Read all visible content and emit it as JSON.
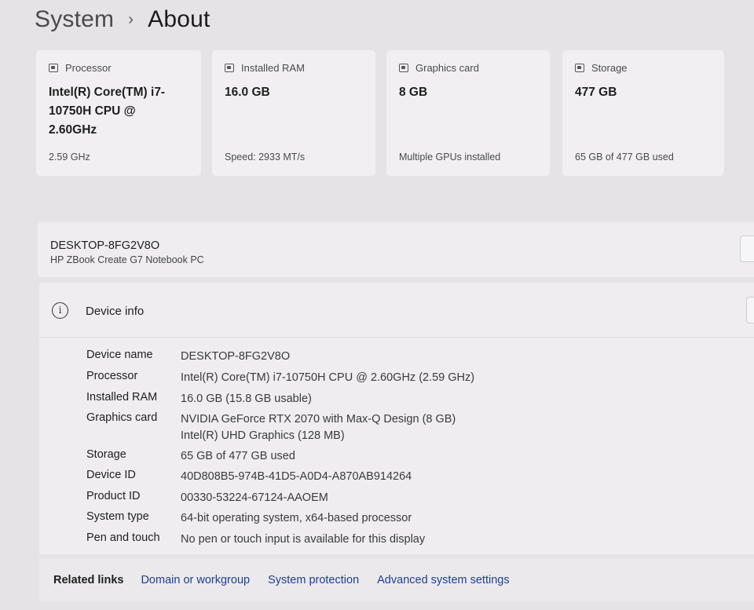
{
  "breadcrumb": {
    "parent": "System",
    "separator": "›",
    "current": "About"
  },
  "cards": [
    {
      "label": "Processor",
      "icon": "processor-icon",
      "value": "Intel(R) Core(TM) i7-10750H CPU @ 2.60GHz",
      "sub": "2.59 GHz"
    },
    {
      "label": "Installed RAM",
      "icon": "ram-icon",
      "value": "16.0 GB",
      "sub": "Speed: 2933 MT/s"
    },
    {
      "label": "Graphics card",
      "icon": "graphics-card-icon",
      "value": "8 GB",
      "sub": "Multiple GPUs installed"
    },
    {
      "label": "Storage",
      "icon": "storage-icon",
      "value": "477 GB",
      "sub": "65 GB of 477 GB used"
    }
  ],
  "device": {
    "name": "DESKTOP-8FG2V8O",
    "model": "HP ZBook Create G7 Notebook PC"
  },
  "device_info": {
    "title": "Device info",
    "icon": "info-icon",
    "specs": [
      {
        "label": "Device name",
        "value": "DESKTOP-8FG2V8O"
      },
      {
        "label": "Processor",
        "value": "Intel(R) Core(TM) i7-10750H CPU @ 2.60GHz (2.59 GHz)"
      },
      {
        "label": "Installed RAM",
        "value": "16.0 GB (15.8 GB usable)"
      },
      {
        "label": "Graphics card",
        "value": "NVIDIA GeForce RTX 2070 with Max-Q Design (8 GB)",
        "value2": "Intel(R) UHD Graphics (128 MB)"
      },
      {
        "label": "Storage",
        "value": "65 GB of 477 GB used"
      },
      {
        "label": "Device ID",
        "value": "40D808B5-974B-41D5-A0D4-A870AB914264"
      },
      {
        "label": "Product ID",
        "value": "00330-53224-67124-AAOEM"
      },
      {
        "label": "System type",
        "value": "64-bit operating system, x64-based processor"
      },
      {
        "label": "Pen and touch",
        "value": "No pen or touch input is available for this display"
      }
    ]
  },
  "related": {
    "label": "Related links",
    "links": [
      "Domain or workgroup",
      "System protection",
      "Advanced system settings"
    ]
  },
  "colors": {
    "background": "#e6e3e6",
    "card": "#f1eff2",
    "link": "#1d3f8f"
  }
}
